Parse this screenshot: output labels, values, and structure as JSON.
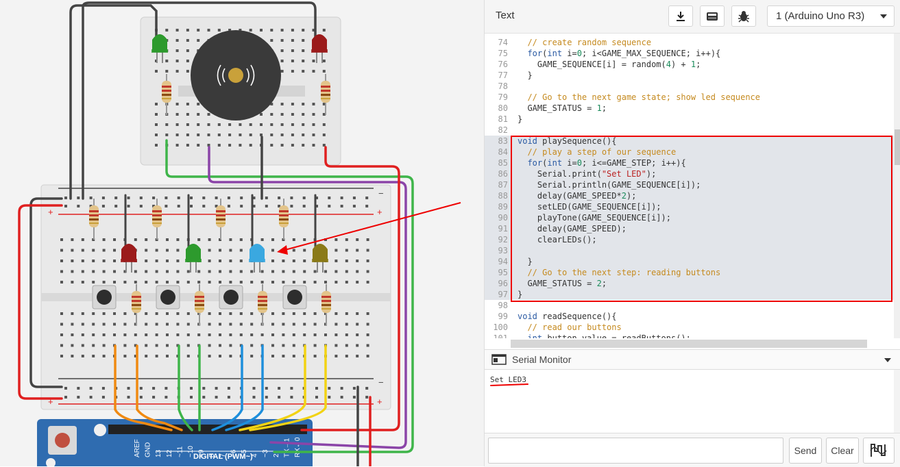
{
  "editor": {
    "mode_label": "Text",
    "board": "1 (Arduino Uno R3)",
    "icons": [
      "download-icon",
      "library-icon",
      "debug-bug-icon"
    ]
  },
  "code_lines": [
    {
      "n": "74",
      "t": "  // create random sequence"
    },
    {
      "n": "75",
      "t": "  for(int i=0; i<GAME_MAX_SEQUENCE; i++){"
    },
    {
      "n": "76",
      "t": "    GAME_SEQUENCE[i] = random(4) + 1;"
    },
    {
      "n": "77",
      "t": "  }"
    },
    {
      "n": "78",
      "t": ""
    },
    {
      "n": "79",
      "t": "  // Go to the next game state; show led sequence"
    },
    {
      "n": "80",
      "t": "  GAME_STATUS = 1;"
    },
    {
      "n": "81",
      "t": "}"
    },
    {
      "n": "82",
      "t": ""
    },
    {
      "n": "83",
      "t": "void playSequence(){"
    },
    {
      "n": "84",
      "t": "  // play a step of our sequence"
    },
    {
      "n": "85",
      "t": "  for(int i=0; i<=GAME_STEP; i++){"
    },
    {
      "n": "86",
      "t": "    Serial.print(\"Set LED\");"
    },
    {
      "n": "87",
      "t": "    Serial.println(GAME_SEQUENCE[i]);"
    },
    {
      "n": "88",
      "t": "    delay(GAME_SPEED*2);"
    },
    {
      "n": "89",
      "t": "    setLED(GAME_SEQUENCE[i]);"
    },
    {
      "n": "90",
      "t": "    playTone(GAME_SEQUENCE[i]);"
    },
    {
      "n": "91",
      "t": "    delay(GAME_SPEED);"
    },
    {
      "n": "92",
      "t": "    clearLEDs();"
    },
    {
      "n": "93",
      "t": ""
    },
    {
      "n": "94",
      "t": "  }"
    },
    {
      "n": "95",
      "t": "  // Go to the next step: reading buttons"
    },
    {
      "n": "96",
      "t": "  GAME_STATUS = 2;"
    },
    {
      "n": "97",
      "t": "}"
    },
    {
      "n": "98",
      "t": ""
    },
    {
      "n": "99",
      "t": "void readSequence(){"
    },
    {
      "n": "100",
      "t": "  // read our buttons"
    },
    {
      "n": "101",
      "t": "  int button_value = readButtons();"
    }
  ],
  "serial": {
    "title": "Serial Monitor",
    "output": "Set LED3",
    "input_value": "",
    "send_label": "Send",
    "clear_label": "Clear"
  },
  "board_labels": {
    "digital": "DIGITAL (PWM~)",
    "pins": [
      "AREF",
      "GND",
      "13",
      "12",
      "~11",
      "~10",
      "~9",
      "8",
      "7",
      "~6",
      "~5",
      "4",
      "~3",
      "2",
      "TX→1",
      "RX←0"
    ],
    "rail_plus": "+",
    "rail_minus": "−"
  },
  "colors": {
    "accent_red": "#e00000",
    "led_red": "#9b1b1b",
    "led_green": "#2d9a2d",
    "led_blue": "#3aa8e0",
    "led_yellow": "#8a7a18",
    "wire_orange": "#f08a12",
    "wire_green": "#3fb54a",
    "wire_blue": "#1e8fdc",
    "wire_yellow": "#f2d314",
    "wire_purple": "#8b45a8",
    "arduino_blue": "#2f6cb0"
  }
}
